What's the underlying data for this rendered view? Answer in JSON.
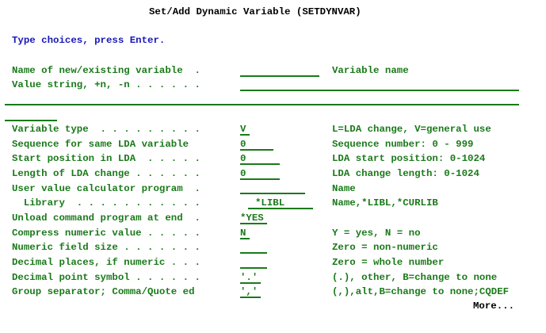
{
  "title": "Set/Add Dynamic Variable (SETDYNVAR)",
  "instructions": "Type choices, press Enter.",
  "variable_name": {
    "prompt": "Name of new/existing variable  .",
    "help": "Variable name",
    "value": ""
  },
  "value_string": {
    "prompt": "Value string, +n, -n . . . . . .",
    "value": ""
  },
  "params": [
    {
      "prompt": "Variable type  . . . . . . . . .",
      "value": "V",
      "help": "L=LDA change, V=general use"
    },
    {
      "prompt": "Sequence for same LDA variable",
      "value": "0",
      "help": "Sequence number: 0 - 999"
    },
    {
      "prompt": "Start position in LDA  . . . . .",
      "value": "0",
      "help": "LDA start position: 0-1024"
    },
    {
      "prompt": "Length of LDA change . . . . . .",
      "value": "0",
      "help": "LDA change length: 0-1024"
    },
    {
      "prompt": "User value calculator program  .",
      "value": "",
      "help": "Name"
    },
    {
      "prompt": "  Library  . . . . . . . . . . .",
      "value": "*LIBL",
      "help": "Name,*LIBL,*CURLIB"
    },
    {
      "prompt": "Unload command program at end  .",
      "value": "*YES",
      "help": ""
    },
    {
      "prompt": "Compress numeric value . . . . .",
      "value": "N",
      "help": "Y = yes, N = no"
    },
    {
      "prompt": "Numeric field size . . . . . . .",
      "value": "",
      "help": "Zero = non-numeric"
    },
    {
      "prompt": "Decimal places, if numeric . . .",
      "value": "",
      "help": "Zero = whole number"
    },
    {
      "prompt": "Decimal point symbol . . . . . .",
      "value": "'.'",
      "help": "(.), other, B=change to none"
    },
    {
      "prompt": "Group separator; Comma/Quote ed",
      "value": "','",
      "help": "(,),alt,B=change to none;CQDEF"
    }
  ],
  "more": "More...",
  "colors": {
    "text": "#000000",
    "field": "#1a7a1a",
    "instruction": "#1818b8"
  }
}
